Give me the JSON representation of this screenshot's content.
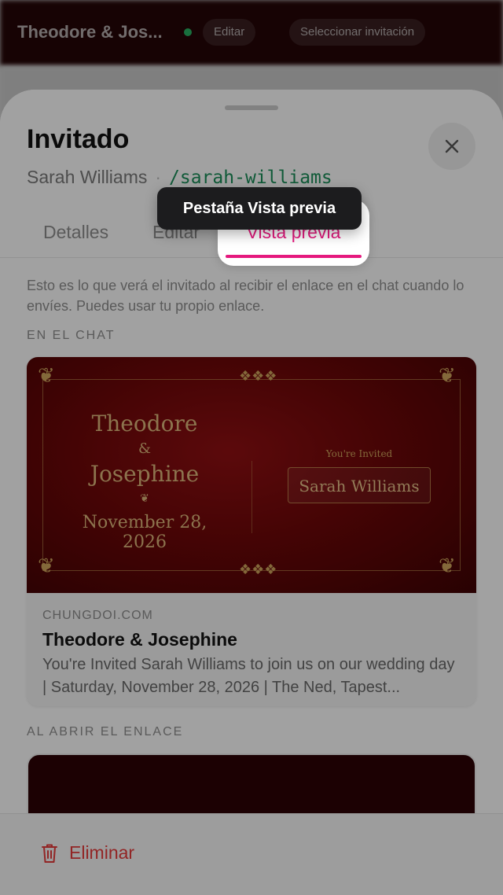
{
  "background": {
    "title": "Theodore & Jos...",
    "chip_edit": "Editar",
    "chip_select": "Seleccionar invitación"
  },
  "sheet": {
    "title": "Invitado",
    "guest_name": "Sarah Williams",
    "separator": "·",
    "slug": "/sarah-williams",
    "close_icon": "close-icon"
  },
  "tabs": [
    {
      "label": "Detalles"
    },
    {
      "label": "Editar"
    },
    {
      "label": "Vista previa",
      "active": true
    }
  ],
  "tooltip": "Pestaña Vista previa",
  "description": "Esto es lo que verá el invitado al recibir el enlace en el chat cuando lo envíes. Puedes usar tu propio enlace.",
  "section_chat": "EN EL CHAT",
  "link_card": {
    "couple_name_1": "Theodore",
    "ampersand": "&",
    "couple_name_2": "Josephine",
    "heart": "❦",
    "date": "November 28, 2026",
    "invited_label": "You're Invited",
    "guest": "Sarah Williams",
    "domain": "CHUNGDOI.COM",
    "title": "Theodore & Josephine",
    "description": "You're Invited Sarah Williams to join us on our wedding day | Saturday, November 28, 2026 | The Ned, Tapest..."
  },
  "section_open": "AL ABRIR EL ENLACE",
  "footer": {
    "delete_label": "Eliminar"
  },
  "colors": {
    "accent": "#e5197e",
    "slug": "#1a8a57",
    "danger": "#e03a3a",
    "invite_bg": "#6a0708",
    "gold": "#c9a05a"
  }
}
